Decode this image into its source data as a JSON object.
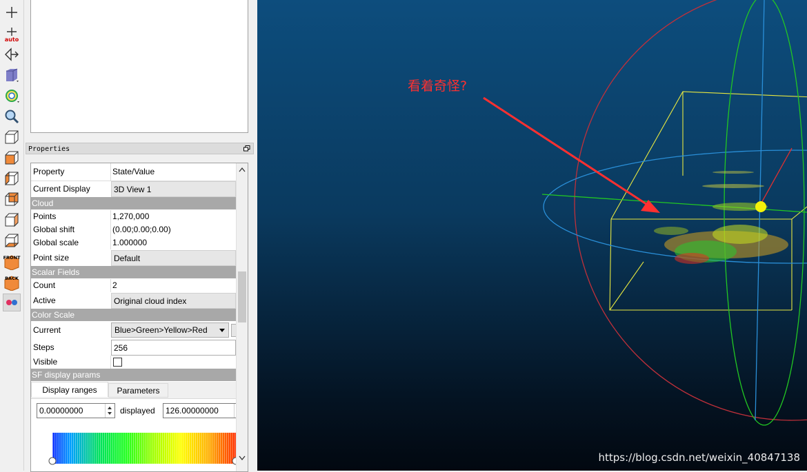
{
  "toolbar": {
    "items": [
      {
        "icon": "plus-icon"
      },
      {
        "icon": "auto-pick-icon",
        "label": "auto"
      },
      {
        "icon": "rotation-center-icon"
      },
      {
        "icon": "perspective-cube-icon"
      },
      {
        "icon": "light-bulb-icon"
      },
      {
        "icon": "zoom-magnifier-icon"
      },
      {
        "icon": "view-top-cube-icon"
      },
      {
        "icon": "view-front-cube-icon"
      },
      {
        "icon": "view-left-cube-icon"
      },
      {
        "icon": "view-back-cube-icon"
      },
      {
        "icon": "view-right-cube-icon"
      },
      {
        "icon": "view-bottom-cube-icon"
      },
      {
        "icon": "iso-front-icon",
        "label": "FRONT"
      },
      {
        "icon": "iso-back-icon",
        "label": "BACK"
      },
      {
        "icon": "stereo-mode-icon"
      }
    ]
  },
  "properties": {
    "title": "Properties",
    "header": {
      "property": "Property",
      "value": "State/Value"
    },
    "current_display": {
      "key": "Current Display",
      "value": "3D View 1"
    },
    "cloud": {
      "section": "Cloud",
      "points": {
        "key": "Points",
        "value": "1,270,000"
      },
      "global_shift": {
        "key": "Global shift",
        "value": "(0.00;0.00;0.00)"
      },
      "global_scale": {
        "key": "Global scale",
        "value": "1.000000"
      },
      "point_size": {
        "key": "Point size",
        "value": "Default"
      }
    },
    "scalar_fields": {
      "section": "Scalar Fields",
      "count": {
        "key": "Count",
        "value": "2"
      },
      "active": {
        "key": "Active",
        "value": "Original cloud index"
      }
    },
    "color_scale": {
      "section": "Color Scale",
      "current": {
        "key": "Current",
        "value": "Blue>Green>Yellow>Red"
      },
      "steps": {
        "key": "Steps",
        "value": "256"
      },
      "visible": {
        "key": "Visible",
        "checked": false
      }
    },
    "sf_display": {
      "section": "SF display params",
      "tabs": [
        "Display ranges",
        "Parameters"
      ],
      "active_tab": "Display ranges",
      "min_value": "0.00000000",
      "displayed_label": "displayed",
      "max_value": "126.00000000"
    }
  },
  "view": {
    "annotation": "看着奇怪?",
    "watermark": "https://blog.csdn.net/weixin_40847138",
    "colors": {
      "sphere": "#c0303a",
      "green_ring": "#22c822",
      "blue_ring": "#2a8fd8",
      "bbox": "#e8e840",
      "arrow": "#ff3030"
    }
  }
}
